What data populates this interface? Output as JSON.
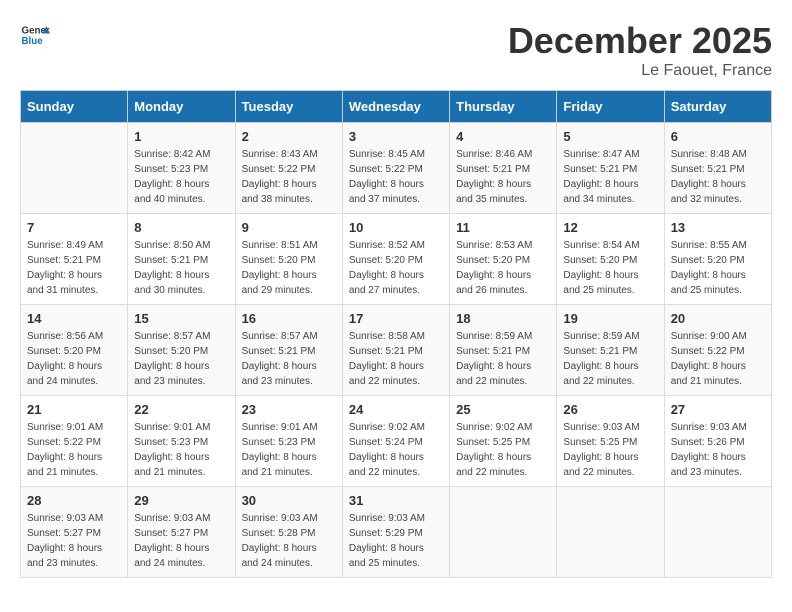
{
  "logo": {
    "line1": "General",
    "line2": "Blue"
  },
  "title": "December 2025",
  "location": "Le Faouet, France",
  "header": {
    "days": [
      "Sunday",
      "Monday",
      "Tuesday",
      "Wednesday",
      "Thursday",
      "Friday",
      "Saturday"
    ]
  },
  "weeks": [
    [
      {
        "day": "",
        "info": ""
      },
      {
        "day": "1",
        "info": "Sunrise: 8:42 AM\nSunset: 5:23 PM\nDaylight: 8 hours\nand 40 minutes."
      },
      {
        "day": "2",
        "info": "Sunrise: 8:43 AM\nSunset: 5:22 PM\nDaylight: 8 hours\nand 38 minutes."
      },
      {
        "day": "3",
        "info": "Sunrise: 8:45 AM\nSunset: 5:22 PM\nDaylight: 8 hours\nand 37 minutes."
      },
      {
        "day": "4",
        "info": "Sunrise: 8:46 AM\nSunset: 5:21 PM\nDaylight: 8 hours\nand 35 minutes."
      },
      {
        "day": "5",
        "info": "Sunrise: 8:47 AM\nSunset: 5:21 PM\nDaylight: 8 hours\nand 34 minutes."
      },
      {
        "day": "6",
        "info": "Sunrise: 8:48 AM\nSunset: 5:21 PM\nDaylight: 8 hours\nand 32 minutes."
      }
    ],
    [
      {
        "day": "7",
        "info": "Sunrise: 8:49 AM\nSunset: 5:21 PM\nDaylight: 8 hours\nand 31 minutes."
      },
      {
        "day": "8",
        "info": "Sunrise: 8:50 AM\nSunset: 5:21 PM\nDaylight: 8 hours\nand 30 minutes."
      },
      {
        "day": "9",
        "info": "Sunrise: 8:51 AM\nSunset: 5:20 PM\nDaylight: 8 hours\nand 29 minutes."
      },
      {
        "day": "10",
        "info": "Sunrise: 8:52 AM\nSunset: 5:20 PM\nDaylight: 8 hours\nand 27 minutes."
      },
      {
        "day": "11",
        "info": "Sunrise: 8:53 AM\nSunset: 5:20 PM\nDaylight: 8 hours\nand 26 minutes."
      },
      {
        "day": "12",
        "info": "Sunrise: 8:54 AM\nSunset: 5:20 PM\nDaylight: 8 hours\nand 25 minutes."
      },
      {
        "day": "13",
        "info": "Sunrise: 8:55 AM\nSunset: 5:20 PM\nDaylight: 8 hours\nand 25 minutes."
      }
    ],
    [
      {
        "day": "14",
        "info": "Sunrise: 8:56 AM\nSunset: 5:20 PM\nDaylight: 8 hours\nand 24 minutes."
      },
      {
        "day": "15",
        "info": "Sunrise: 8:57 AM\nSunset: 5:20 PM\nDaylight: 8 hours\nand 23 minutes."
      },
      {
        "day": "16",
        "info": "Sunrise: 8:57 AM\nSunset: 5:21 PM\nDaylight: 8 hours\nand 23 minutes."
      },
      {
        "day": "17",
        "info": "Sunrise: 8:58 AM\nSunset: 5:21 PM\nDaylight: 8 hours\nand 22 minutes."
      },
      {
        "day": "18",
        "info": "Sunrise: 8:59 AM\nSunset: 5:21 PM\nDaylight: 8 hours\nand 22 minutes."
      },
      {
        "day": "19",
        "info": "Sunrise: 8:59 AM\nSunset: 5:21 PM\nDaylight: 8 hours\nand 22 minutes."
      },
      {
        "day": "20",
        "info": "Sunrise: 9:00 AM\nSunset: 5:22 PM\nDaylight: 8 hours\nand 21 minutes."
      }
    ],
    [
      {
        "day": "21",
        "info": "Sunrise: 9:01 AM\nSunset: 5:22 PM\nDaylight: 8 hours\nand 21 minutes."
      },
      {
        "day": "22",
        "info": "Sunrise: 9:01 AM\nSunset: 5:23 PM\nDaylight: 8 hours\nand 21 minutes."
      },
      {
        "day": "23",
        "info": "Sunrise: 9:01 AM\nSunset: 5:23 PM\nDaylight: 8 hours\nand 21 minutes."
      },
      {
        "day": "24",
        "info": "Sunrise: 9:02 AM\nSunset: 5:24 PM\nDaylight: 8 hours\nand 22 minutes."
      },
      {
        "day": "25",
        "info": "Sunrise: 9:02 AM\nSunset: 5:25 PM\nDaylight: 8 hours\nand 22 minutes."
      },
      {
        "day": "26",
        "info": "Sunrise: 9:03 AM\nSunset: 5:25 PM\nDaylight: 8 hours\nand 22 minutes."
      },
      {
        "day": "27",
        "info": "Sunrise: 9:03 AM\nSunset: 5:26 PM\nDaylight: 8 hours\nand 23 minutes."
      }
    ],
    [
      {
        "day": "28",
        "info": "Sunrise: 9:03 AM\nSunset: 5:27 PM\nDaylight: 8 hours\nand 23 minutes."
      },
      {
        "day": "29",
        "info": "Sunrise: 9:03 AM\nSunset: 5:27 PM\nDaylight: 8 hours\nand 24 minutes."
      },
      {
        "day": "30",
        "info": "Sunrise: 9:03 AM\nSunset: 5:28 PM\nDaylight: 8 hours\nand 24 minutes."
      },
      {
        "day": "31",
        "info": "Sunrise: 9:03 AM\nSunset: 5:29 PM\nDaylight: 8 hours\nand 25 minutes."
      },
      {
        "day": "",
        "info": ""
      },
      {
        "day": "",
        "info": ""
      },
      {
        "day": "",
        "info": ""
      }
    ]
  ]
}
